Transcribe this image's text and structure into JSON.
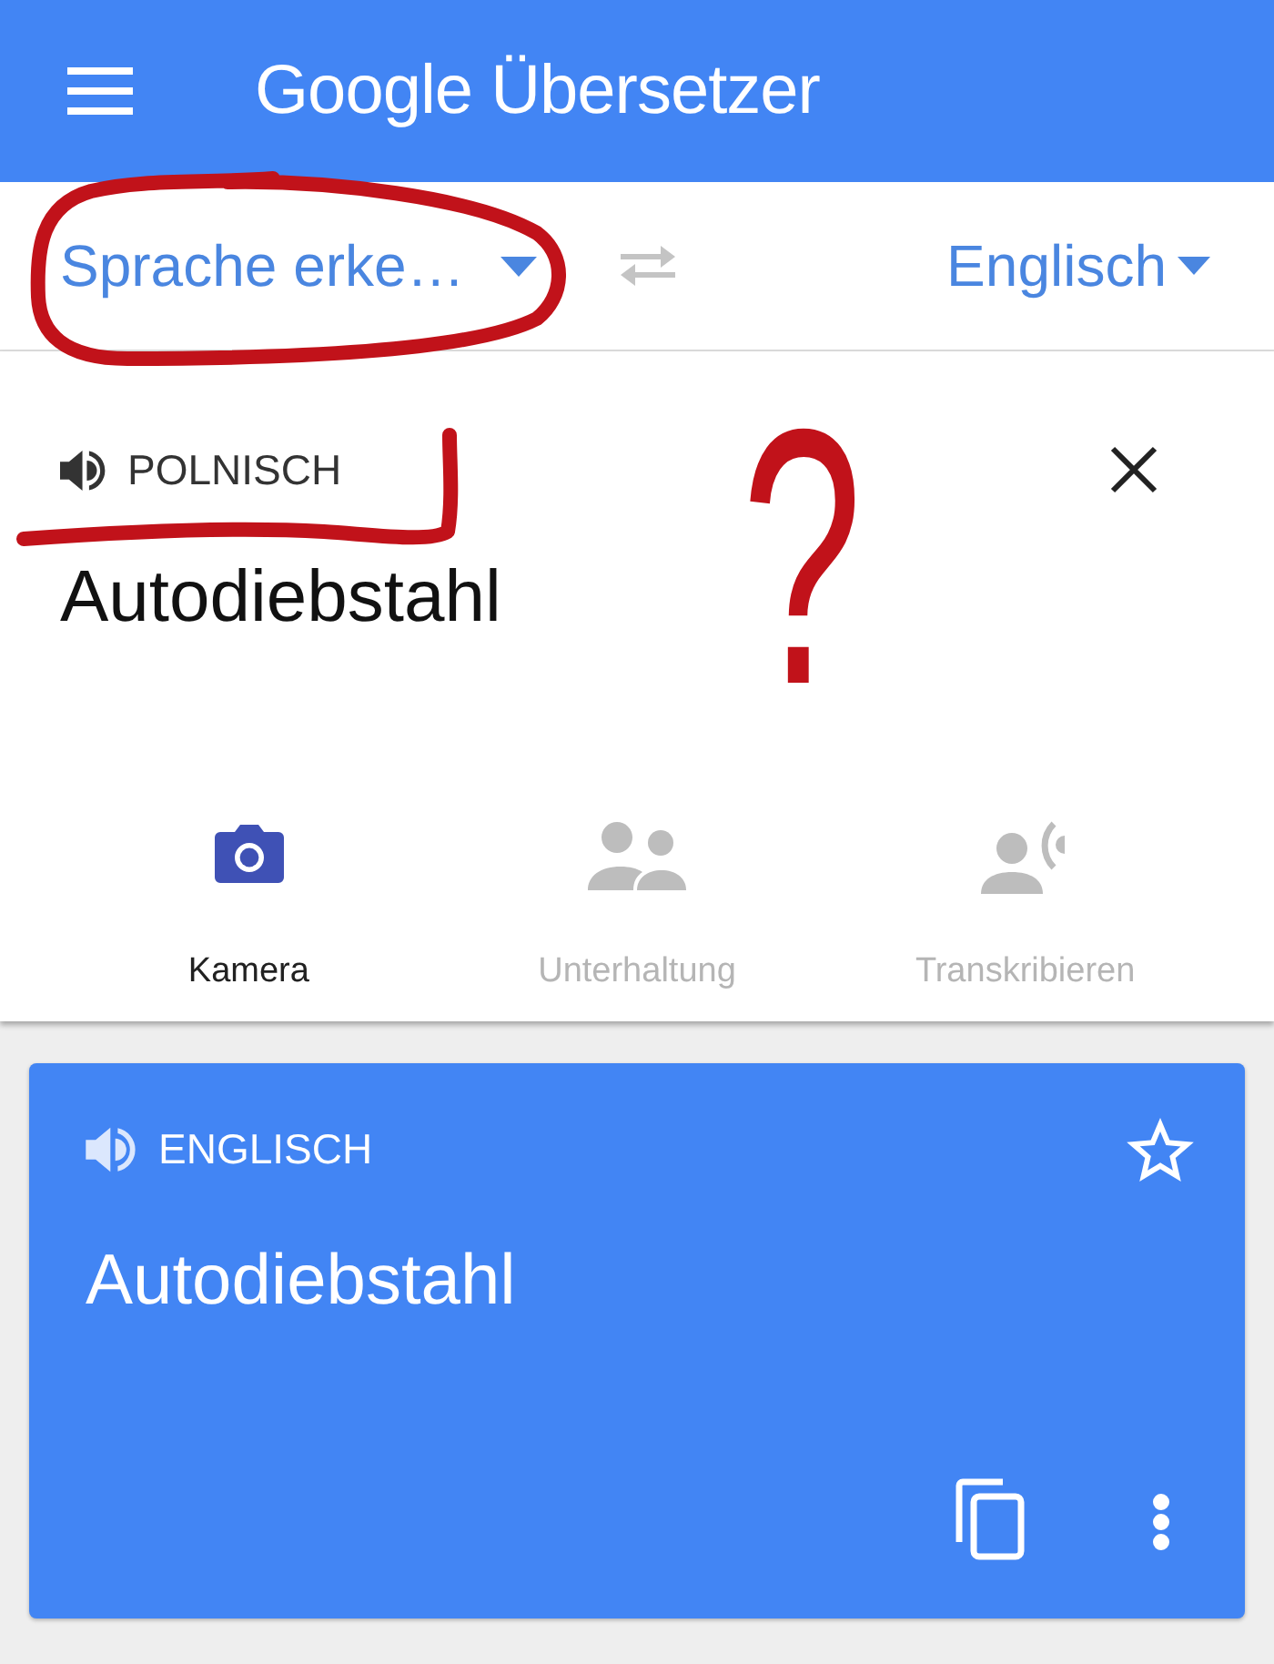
{
  "app_bar": {
    "title": "Google Übersetzer"
  },
  "language_bar": {
    "source": "Sprache erke…",
    "swap_disabled": true,
    "target": "Englisch"
  },
  "input": {
    "detected_language": "POLNISCH",
    "value": "Autodiebstahl"
  },
  "modes": [
    {
      "kind": "camera",
      "label": "Kamera",
      "selected": true
    },
    {
      "kind": "conversation",
      "label": "Unterhaltung",
      "selected": false
    },
    {
      "kind": "transcribe",
      "label": "Transkribieren",
      "selected": false
    }
  ],
  "translation": {
    "language": "ENGLISCH",
    "text": "Autodiebstahl",
    "starred": false
  },
  "annotation": {
    "text": "?"
  }
}
